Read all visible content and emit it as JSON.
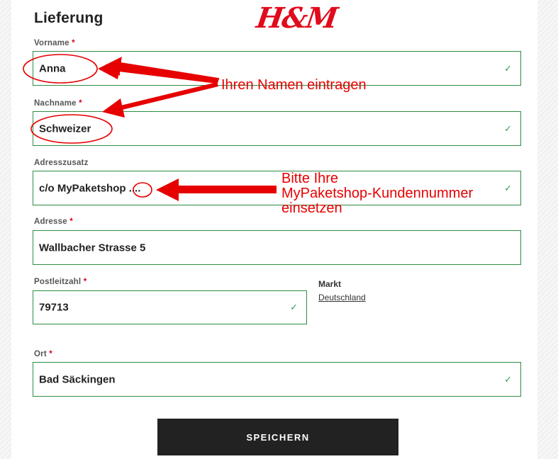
{
  "header": {
    "title": "Lieferung",
    "brand_logo": "H&M"
  },
  "form": {
    "vorname": {
      "label": "Vorname",
      "required_mark": "*",
      "value": "Anna",
      "status_icon": "checkmark-icon"
    },
    "nachname": {
      "label": "Nachname",
      "required_mark": "*",
      "value": "Schweizer",
      "status_icon": "checkmark-icon"
    },
    "adresszusatz": {
      "label": "Adresszusatz",
      "value": "c/o MyPaketshop ....",
      "status_icon": "checkmark-icon"
    },
    "adresse": {
      "label": "Adresse",
      "required_mark": "*",
      "value": "Wallbacher Strasse 5"
    },
    "postleitzahl": {
      "label": "Postleitzahl",
      "required_mark": "*",
      "value": "79713",
      "status_icon": "checkmark-icon"
    },
    "markt": {
      "label": "Markt",
      "value": "Deutschland"
    },
    "ort": {
      "label": "Ort",
      "required_mark": "*",
      "value": "Bad Säckingen",
      "status_icon": "checkmark-icon"
    },
    "save_label": "SPEICHERN"
  },
  "annotations": {
    "name_hint": "Ihren Namen eintragen",
    "customer_number_hint_line1": "Bitte Ihre",
    "customer_number_hint_line2": "MyPaketshop-Kundennummer",
    "customer_number_hint_line3": "einsetzen",
    "annotation_color": "#e60000"
  },
  "colors": {
    "brand_red": "#e00b1c",
    "valid_border": "#2f8c46",
    "button_bg": "#222222"
  }
}
